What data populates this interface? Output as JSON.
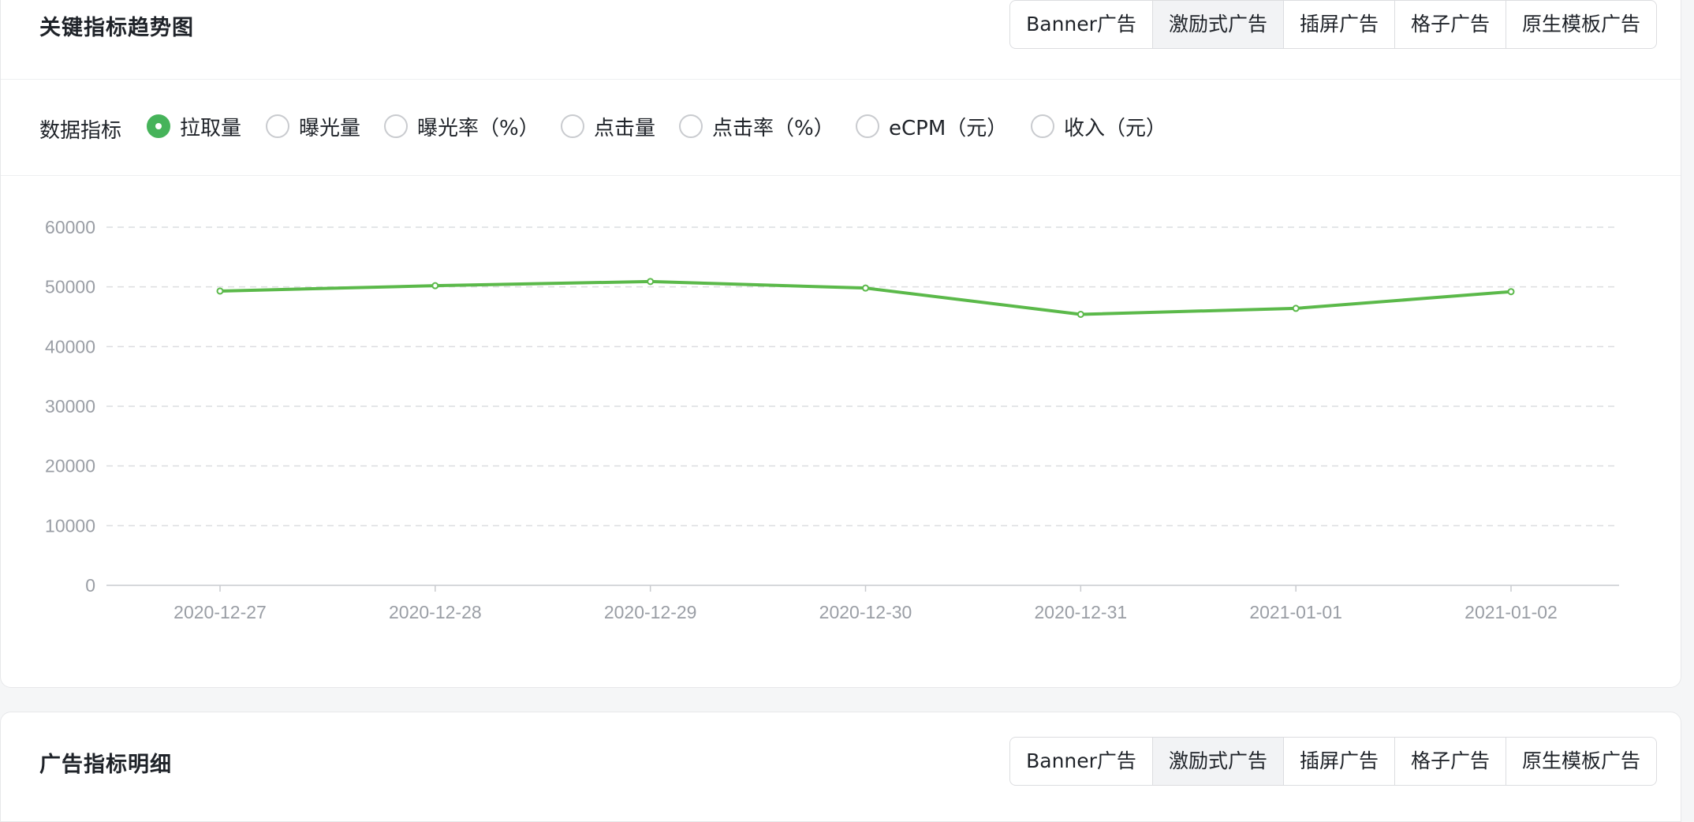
{
  "trend_card": {
    "title": "关键指标趋势图",
    "ad_types": [
      "Banner广告",
      "激励式广告",
      "插屏广告",
      "格子广告",
      "原生模板广告"
    ],
    "active_ad_type": "激励式广告",
    "metric_label": "数据指标",
    "metrics": [
      "拉取量",
      "曝光量",
      "曝光率（%）",
      "点击量",
      "点击率（%）",
      "eCPM（元）",
      "收入（元）"
    ],
    "selected_metric": "拉取量"
  },
  "detail_card": {
    "title": "广告指标明细",
    "ad_types": [
      "Banner广告",
      "激励式广告",
      "插屏广告",
      "格子广告",
      "原生模板广告"
    ],
    "active_ad_type": "激励式广告"
  },
  "colors": {
    "accent": "#46b35a",
    "line": "#5bb94a",
    "grid": "#dcdde0",
    "tick_text": "#9a9ea5"
  },
  "chart_data": {
    "type": "line",
    "x": [
      "2020-12-27",
      "2020-12-28",
      "2020-12-29",
      "2020-12-30",
      "2020-12-31",
      "2021-01-01",
      "2021-01-02"
    ],
    "series": [
      {
        "values": [
          49300,
          50200,
          50900,
          49800,
          45400,
          46400,
          49200
        ]
      }
    ],
    "yticks": [
      0,
      10000,
      20000,
      30000,
      40000,
      50000,
      60000
    ],
    "ylim": [
      0,
      60000
    ],
    "grid": true,
    "legend": "none"
  }
}
